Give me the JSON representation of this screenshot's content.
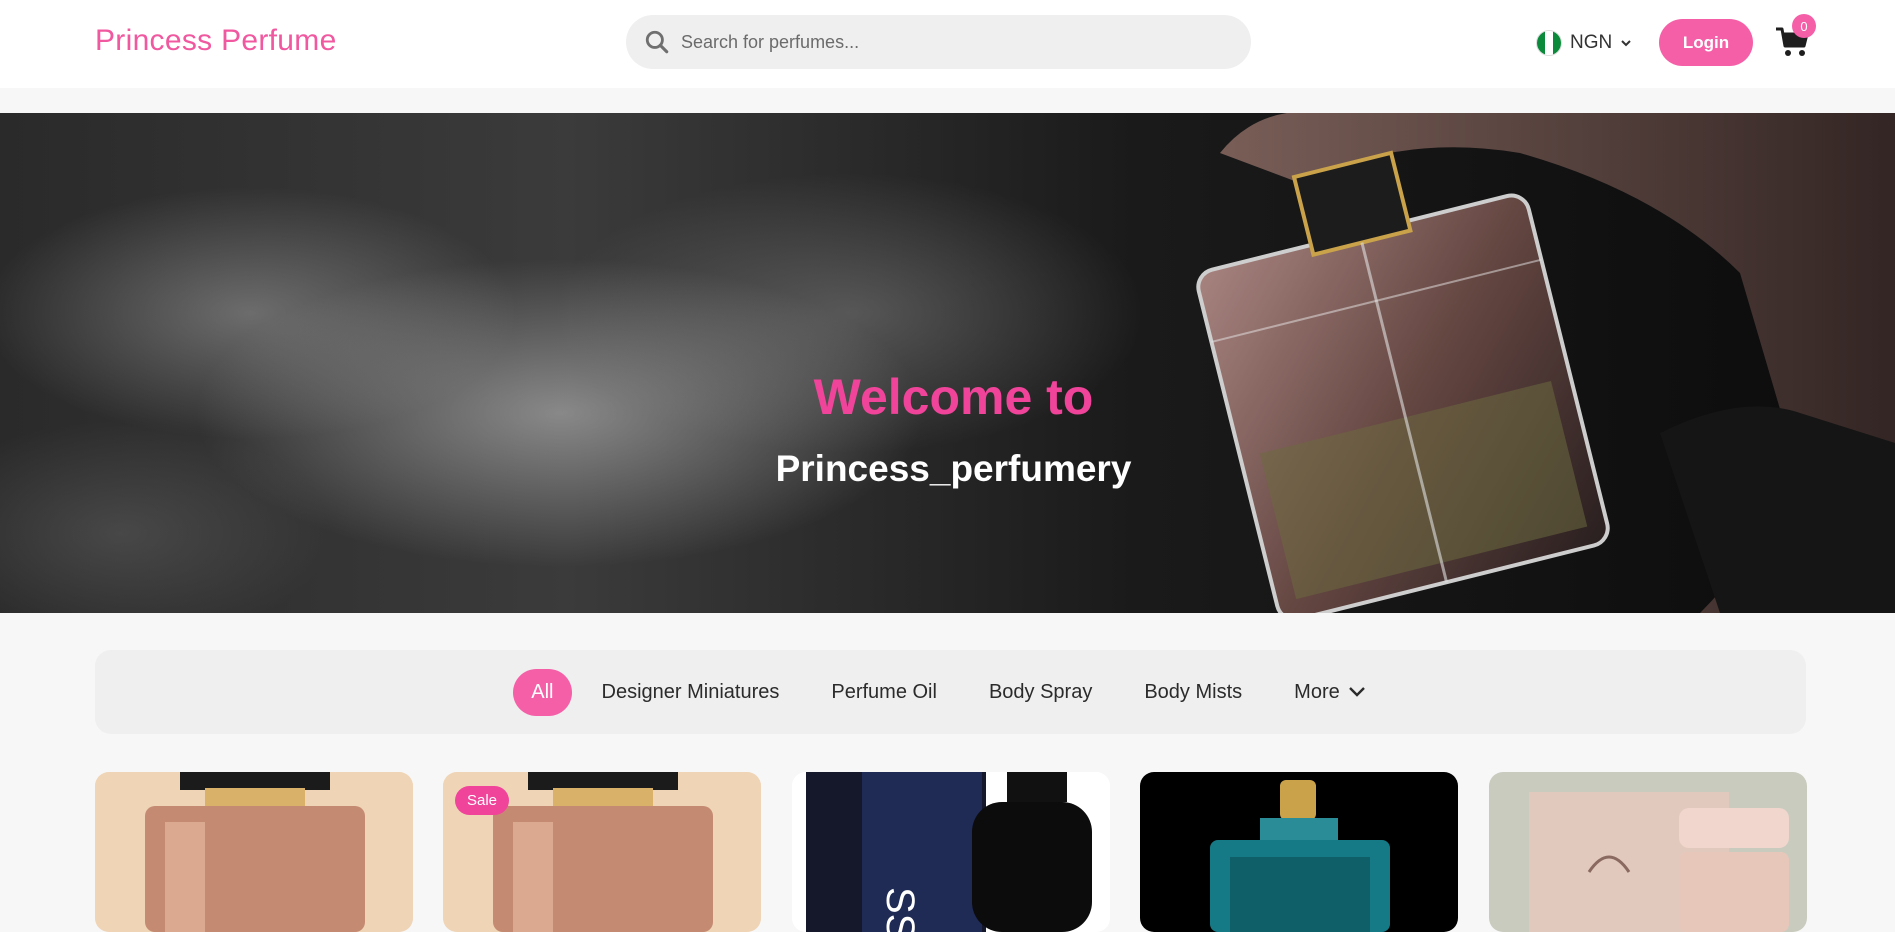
{
  "header": {
    "brand": "Princess Perfume",
    "search_placeholder": "Search for perfumes...",
    "currency": "NGN",
    "login_label": "Login",
    "cart_count": "0"
  },
  "hero": {
    "title": "Welcome to",
    "subtitle": "Princess_perfumery"
  },
  "categories": {
    "items": [
      "All",
      "Designer Miniatures",
      "Perfume Oil",
      "Body Spray",
      "Body Mists",
      "More"
    ],
    "active": "All"
  },
  "products": {
    "badges": [
      "",
      "Sale",
      "",
      "",
      ""
    ]
  },
  "colors": {
    "accent": "#f45fa8",
    "brand_text": "#f0589f",
    "hero_title": "#f0439a"
  },
  "icons": [
    "search-icon",
    "nigeria-flag-icon",
    "chevron-down-icon",
    "cart-icon"
  ]
}
